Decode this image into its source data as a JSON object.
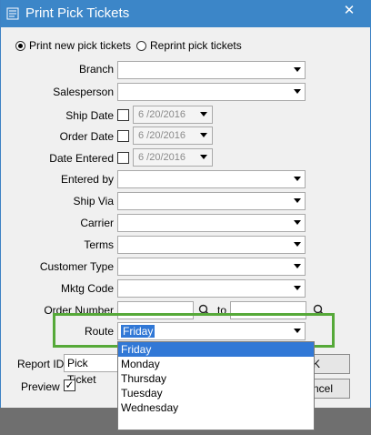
{
  "window": {
    "title": "Print Pick Tickets",
    "close_glyph": "✕"
  },
  "mode": {
    "print_new_label": "Print new pick tickets",
    "reprint_label": "Reprint pick tickets",
    "selected": "print_new"
  },
  "fields": {
    "branch": {
      "label": "Branch",
      "value": ""
    },
    "salesperson": {
      "label": "Salesperson",
      "value": ""
    },
    "ship_date": {
      "label": "Ship Date",
      "value": "6 /20/2016"
    },
    "order_date": {
      "label": "Order Date",
      "value": "6 /20/2016"
    },
    "date_entered": {
      "label": "Date Entered",
      "value": "6 /20/2016"
    },
    "entered_by": {
      "label": "Entered by",
      "value": ""
    },
    "ship_via": {
      "label": "Ship Via",
      "value": ""
    },
    "carrier": {
      "label": "Carrier",
      "value": ""
    },
    "terms": {
      "label": "Terms",
      "value": ""
    },
    "customer_type": {
      "label": "Customer Type",
      "value": ""
    },
    "mktg_code": {
      "label": "Mktg Code",
      "value": ""
    },
    "order_number": {
      "label": "Order Number",
      "to_label": "to",
      "from": "",
      "to": ""
    },
    "route": {
      "label": "Route",
      "value": "Friday"
    }
  },
  "route_options": [
    "Friday",
    "Monday",
    "Thursday",
    "Tuesday",
    "Wednesday"
  ],
  "report": {
    "label": "Report ID",
    "value": "Pick Ticket"
  },
  "preview": {
    "label": "Preview",
    "checked": true,
    "check_glyph": "✓"
  },
  "buttons": {
    "ok_partial": "K",
    "cancel_partial": "ncel"
  },
  "colors": {
    "titlebar": "#3c86c8",
    "highlight": "#56a939",
    "selection": "#3178d6"
  }
}
